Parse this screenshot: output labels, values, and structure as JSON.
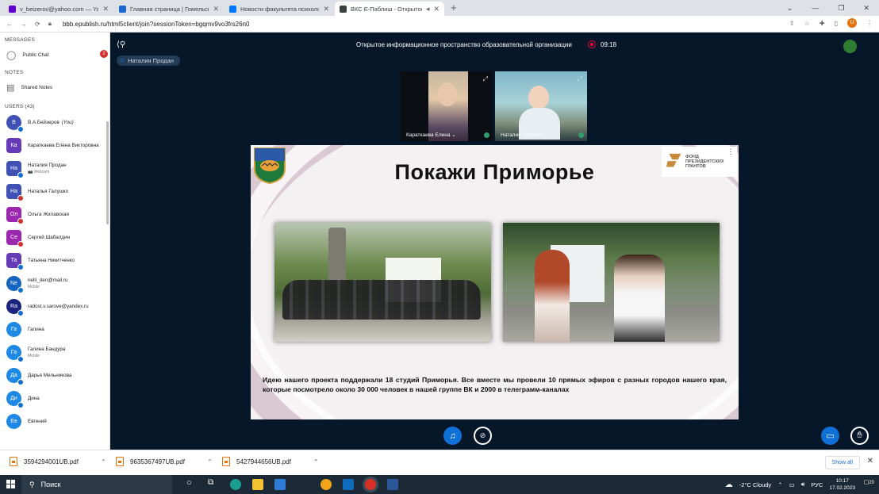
{
  "browser": {
    "tabs": [
      {
        "title": "v_beizerov@yahoo.com — Yahoo",
        "color": "#6001d2"
      },
      {
        "title": "Главная страница | Гомельский г",
        "color": "#1967d2"
      },
      {
        "title": "Новости факультета психологии",
        "color": "#0077ff"
      },
      {
        "title": "ВКС Е-Паблиш - Открытое",
        "color": "#3c4043",
        "active": true
      }
    ],
    "new_tab": "+",
    "url": "bbb.epublish.ru/html5client/join?sessionToken=bgqmv9vo3frs26n0",
    "profile_initial": "U"
  },
  "sidebar": {
    "messages_title": "MESSAGES",
    "public_chat": "Public Chat",
    "public_chat_badge": "2",
    "notes_title": "NOTES",
    "shared_notes": "Shared Notes",
    "users_title": "USERS (43)",
    "users": [
      {
        "initials": "В",
        "name": "В.А.Бейзеров",
        "you": "(You)",
        "color": "#3f51b5",
        "dot": "#0f6fd6",
        "round": true
      },
      {
        "initials": "Ка",
        "name": "Караткаева Елена Викторовна",
        "color": "#673ab7",
        "dot": "",
        "round": false
      },
      {
        "initials": "На",
        "name": "Наталия Продан",
        "sub": "📷 Webcam",
        "color": "#3f51b5",
        "dot": "#0f6fd6",
        "round": false
      },
      {
        "initials": "На",
        "name": "Наталья Галушко",
        "color": "#3f51b5",
        "dot": "#d32f2f",
        "round": false
      },
      {
        "initials": "Ол",
        "name": "Ольга Жилавская",
        "color": "#9c27b0",
        "dot": "#d32f2f",
        "round": false
      },
      {
        "initials": "Се",
        "name": "Сергей Шабалдин",
        "color": "#9c27b0",
        "dot": "#d32f2f",
        "round": false
      },
      {
        "initials": "Та",
        "name": "Татьяна Никитченко",
        "color": "#673ab7",
        "dot": "#0f6fd6",
        "round": false
      },
      {
        "initials": "Ne",
        "name": "nelli_den@mail.ru",
        "sub": "Mobile",
        "color": "#1565c0",
        "dot": "#0f6fd6",
        "round": true
      },
      {
        "initials": "Ra",
        "name": "radost.v.sarove@yandex.ru",
        "color": "#1a237e",
        "dot": "#0f6fd6",
        "round": true
      },
      {
        "initials": "Га",
        "name": "Галина",
        "color": "#1e88e5",
        "dot": "",
        "round": true
      },
      {
        "initials": "Га",
        "name": "Галина Бандура",
        "sub": "Mobile",
        "color": "#1e88e5",
        "dot": "#0f6fd6",
        "round": true
      },
      {
        "initials": "Да",
        "name": "Дарья Мельникова",
        "color": "#1e88e5",
        "dot": "#0f6fd6",
        "round": true
      },
      {
        "initials": "Ди",
        "name": "Дина",
        "color": "#1e88e5",
        "dot": "#0f6fd6",
        "round": true
      },
      {
        "initials": "Ев",
        "name": "Евгений",
        "color": "#1e88e5",
        "dot": "",
        "round": true
      }
    ]
  },
  "meeting": {
    "title": "Открытое информационное пространство образовательной организации",
    "timer": "09:18",
    "presenter": "Наталия Продан",
    "cams": [
      {
        "name": "Караткаева Елена ⌄"
      },
      {
        "name": "Наталия Продан ⌄"
      }
    ]
  },
  "slide": {
    "title": "Покажи Приморье",
    "fund_text": [
      "ФОНД",
      "ПРЕЗИДЕНТСКИХ",
      "ГРАНТОВ"
    ],
    "body": "Идею нашего проекта поддержали 18 студий Приморья. Все вместе мы провели 10 прямых эфиров с разных городов нашего края, которые посмотрело около 30 000 человек в нашей группе ВК и 2000 в телеграмм-каналах"
  },
  "downloads": {
    "items": [
      "3594294001UB.pdf",
      "9635367497UB.pdf",
      "5427944656UB.pdf"
    ],
    "show_all": "Show all"
  },
  "taskbar": {
    "search_label": "Поиск",
    "weather": "-2°C  Cloudy",
    "lang": "РУС",
    "time": "10:17",
    "date": "17.02.2023",
    "notif_count": "20"
  }
}
